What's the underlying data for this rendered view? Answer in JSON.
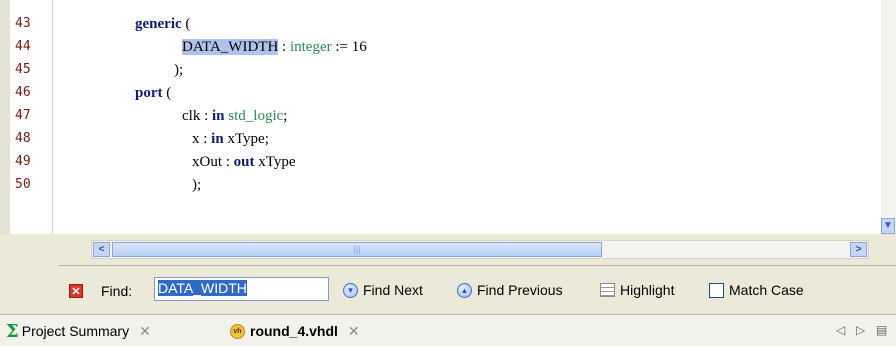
{
  "editor": {
    "lines": [
      {
        "num": "43",
        "indent": 0,
        "parts": [
          {
            "t": "generic",
            "c": "kw"
          },
          {
            "t": " (",
            "c": ""
          }
        ]
      },
      {
        "num": "44",
        "indent": 1,
        "parts": [
          {
            "t": "DATA_WIDTH",
            "c": "hl"
          },
          {
            "t": " : ",
            "c": ""
          },
          {
            "t": "integer",
            "c": "ty"
          },
          {
            "t": " := 16",
            "c": ""
          }
        ]
      },
      {
        "num": "45",
        "indent": 2,
        "parts": [
          {
            "t": ");",
            "c": ""
          }
        ]
      },
      {
        "num": "46",
        "indent": 0,
        "parts": [
          {
            "t": "port",
            "c": "kw"
          },
          {
            "t": " (",
            "c": ""
          }
        ]
      },
      {
        "num": "47",
        "indent": 3,
        "parts": [
          {
            "t": "clk : ",
            "c": ""
          },
          {
            "t": "in",
            "c": "kw"
          },
          {
            "t": " ",
            "c": ""
          },
          {
            "t": "std_logic",
            "c": "ty"
          },
          {
            "t": ";",
            "c": ""
          }
        ]
      },
      {
        "num": "48",
        "indent": 4,
        "parts": [
          {
            "t": "x : ",
            "c": ""
          },
          {
            "t": "in",
            "c": "kw"
          },
          {
            "t": " xType;",
            "c": ""
          }
        ]
      },
      {
        "num": "49",
        "indent": 4,
        "parts": [
          {
            "t": "xOut : ",
            "c": ""
          },
          {
            "t": "out",
            "c": "kw"
          },
          {
            "t": " xType",
            "c": ""
          }
        ]
      },
      {
        "num": "50",
        "indent": 5,
        "parts": [
          {
            "t": ");",
            "c": ""
          }
        ]
      }
    ]
  },
  "find_bar": {
    "find_label": "Find:",
    "find_value": "DATA_WIDTH",
    "find_next_label": "Find Next",
    "find_previous_label": "Find Previous",
    "highlight_label": "Highlight",
    "match_case_label": "Match Case",
    "match_case_checked": false
  },
  "tabs": [
    {
      "label": "Project Summary",
      "icon": "sigma-icon",
      "active": false
    },
    {
      "label": "round_4.vhdl",
      "icon": "vhdl-file-icon",
      "active": true
    }
  ],
  "colors": {
    "keyword": "#0a1f73",
    "type": "#2e8b57",
    "line_number": "#7a1a12",
    "highlight": "#aec3e9"
  }
}
